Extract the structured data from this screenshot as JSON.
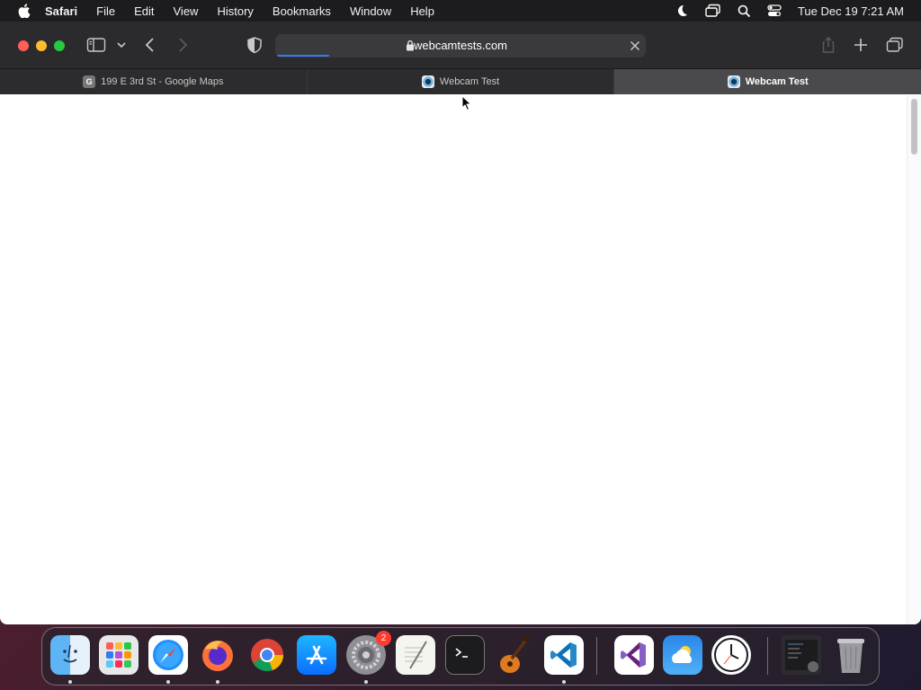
{
  "menubar": {
    "app_name": "Safari",
    "items": [
      "File",
      "Edit",
      "View",
      "History",
      "Bookmarks",
      "Window",
      "Help"
    ],
    "clock": "Tue Dec 19  7:21 AM",
    "status_icons": [
      "moon-icon",
      "screen-mirroring-icon",
      "spotlight-search-icon",
      "control-center-icon"
    ]
  },
  "toolbar": {
    "url": "webcamtests.com",
    "page_load_progress": 0.14
  },
  "tabs": [
    {
      "title": "199 E 3rd St - Google Maps",
      "favicon_letter": "G",
      "active": false
    },
    {
      "title": "Webcam Test",
      "active": false
    },
    {
      "title": "Webcam Test",
      "active": true
    }
  ],
  "dock": {
    "apps": [
      "Finder",
      "Launchpad",
      "Safari",
      "Firefox",
      "Google Chrome",
      "App Store",
      "System Preferences",
      "TextEdit",
      "Terminal",
      "GarageBand",
      "Visual Studio Code",
      "Visual Studio",
      "Weather",
      "Clock",
      "Downloads",
      "Trash"
    ],
    "system_preferences_badge": "2"
  },
  "colors": {
    "close": "#ff5f57",
    "minimize": "#febc2e",
    "maximize": "#28c840",
    "progress": "#2f7cf6"
  }
}
